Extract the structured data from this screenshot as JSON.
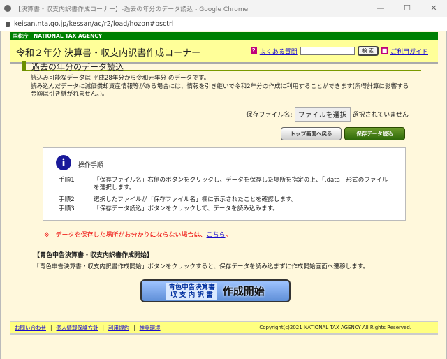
{
  "window": {
    "title": "【決算書・収支内訳書作成コーナー】-過去の年分のデータ読込 - Google Chrome",
    "minimize": "—",
    "maximize": "☐",
    "close": "✕",
    "url": "keisan.nta.go.jp/kessan/ac/r2/load/hozon#bsctrl"
  },
  "header": {
    "agency": "国税庁　NATIONAL TAX AGENCY",
    "title": "令和２年分 決算書・収支内訳書作成コーナー",
    "faq": "よくある質問",
    "faq_icon": "?",
    "search_button": "検 索",
    "guide": "ご利用ガイド",
    "search_value": ""
  },
  "section": {
    "title": "過去の年分のデータ読込",
    "line1": "読込み可能なデータは 平成28年分から令和元年分 のデータです。",
    "line2": "読み込んだデータに減価償却資産情報等がある場合には、情報を引き継いで令和2年分の作成に利用することができます(所得計算に影響する金額は引き継がれません。)。"
  },
  "file": {
    "label": "保存ファイル名:",
    "button": "ファイルを選択",
    "status": "選択されていません"
  },
  "buttons": {
    "top": "トップ画面へ戻る",
    "load": "保存データ読込"
  },
  "instructions": {
    "title": "操作手順",
    "steps": [
      {
        "n": "手順1",
        "d": "「保存ファイル名」右側のボタンをクリックし、データを保存した場所を指定の上、「.data」形式のファイルを選択します。"
      },
      {
        "n": "手順2",
        "d": "選択したファイルが「保存ファイル名」欄に表示されたことを確認します。"
      },
      {
        "n": "手順3",
        "d": "「保存データ読込」ボタンをクリックして、データを読み込みます。"
      }
    ]
  },
  "note": {
    "prefix": "※　データを保存した場所がお分かりにならない場合は、",
    "link": "こちら",
    "suffix": "。"
  },
  "blue": {
    "heading": "【青色申告決算書・収支内訳書作成開始】",
    "desc": "「青色申告決算書・収支内訳書作成開始」ボタンをクリックすると、保存データを読み込まずに作成開始画面へ遷移します。",
    "btn_left1": "青色申告決算書",
    "btn_left2": "収 支 内 訳 書",
    "btn_right": "作成開始"
  },
  "footer": {
    "links": [
      "お問い合わせ",
      "個人情報保護方針",
      "利用規約",
      "推奨環境"
    ],
    "sep": "|",
    "copyright": "Copyright(c)2021 NATIONAL TAX AGENCY All Rights Reserved."
  }
}
